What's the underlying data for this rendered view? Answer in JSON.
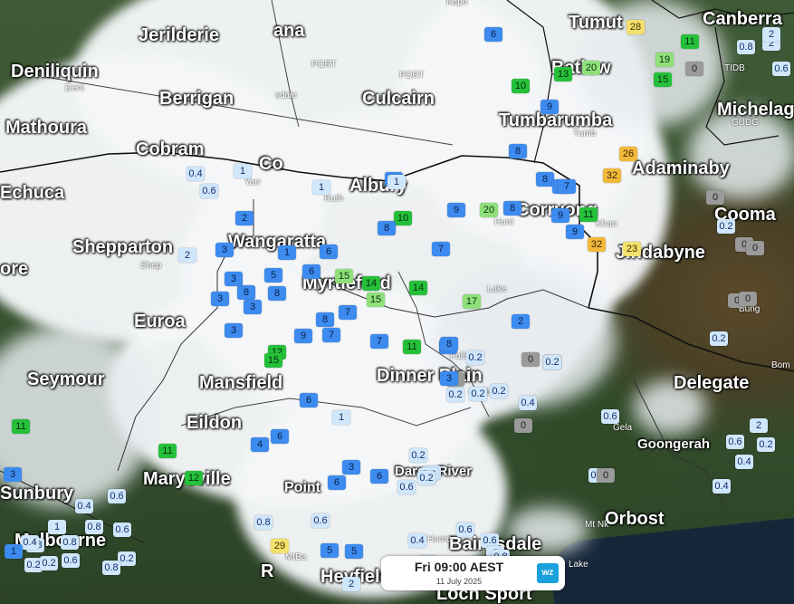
{
  "map": {
    "towns": [
      {
        "name": "Jerilderie"
      },
      {
        "name": "ana"
      },
      {
        "name": "Deniliquin"
      },
      {
        "name": "Berrigan"
      },
      {
        "name": "Culcairn"
      },
      {
        "name": "Tumut"
      },
      {
        "name": "Batlow"
      },
      {
        "name": "Canberra"
      },
      {
        "name": "Mathoura"
      },
      {
        "name": "Tumbarumba"
      },
      {
        "name": "Michelago"
      },
      {
        "name": "Cobram"
      },
      {
        "name": "Co"
      },
      {
        "name": "Adaminaby"
      },
      {
        "name": "Echuca"
      },
      {
        "name": "Albury"
      },
      {
        "name": "Corryong"
      },
      {
        "name": "Cooma"
      },
      {
        "name": "Wangaratta"
      },
      {
        "name": "Shepparton"
      },
      {
        "name": "Jindabyne"
      },
      {
        "name": "Myrtleford"
      },
      {
        "name": "Euroa"
      },
      {
        "name": "Seymour"
      },
      {
        "name": "Dinner Plain"
      },
      {
        "name": "Mansfield"
      },
      {
        "name": "Delegate"
      },
      {
        "name": "Eildon"
      },
      {
        "name": "Goongerah"
      },
      {
        "name": "Marysville"
      },
      {
        "name": "Dargo River"
      },
      {
        "name": "Orbost"
      },
      {
        "name": "Bairnsdale"
      },
      {
        "name": "Melbourne"
      },
      {
        "name": "Heyfield"
      },
      {
        "name": "Loch Sport"
      },
      {
        "name": "Point"
      },
      {
        "name": "R"
      },
      {
        "name": "Sunbury"
      },
      {
        "name": "ore"
      }
    ],
    "stations": [
      "Kapo",
      "PORT",
      "PORT",
      "sdale",
      "Deni",
      "Yarr",
      "Ruth",
      "Hunt",
      "Khan",
      "Shep",
      "Lake",
      "Bung",
      "Bom",
      "Gela",
      "Mt Nk",
      "Tumb",
      "TIDB",
      "GUDG",
      "Falls",
      "Cobb",
      "Hume",
      "Lake",
      "MtBa"
    ],
    "observations": [
      {
        "v": "6",
        "c": "blue"
      },
      {
        "v": "28",
        "c": "yellow"
      },
      {
        "v": "11",
        "c": "green"
      },
      {
        "v": "2",
        "c": "light"
      },
      {
        "v": "0.8",
        "c": "light"
      },
      {
        "v": "2",
        "c": "light"
      },
      {
        "v": "0.6",
        "c": "light"
      },
      {
        "v": "20",
        "c": "lgreen"
      },
      {
        "v": "13",
        "c": "green"
      },
      {
        "v": "19",
        "c": "lgreen"
      },
      {
        "v": "0",
        "c": "grey"
      },
      {
        "v": "15",
        "c": "green"
      },
      {
        "v": "10",
        "c": "green"
      },
      {
        "v": "8",
        "c": "blue"
      },
      {
        "v": "8",
        "c": "blue"
      },
      {
        "v": "9",
        "c": "blue"
      },
      {
        "v": "26",
        "c": "amber"
      },
      {
        "v": "32",
        "c": "amber"
      },
      {
        "v": "0.4",
        "c": "light"
      },
      {
        "v": "1",
        "c": "light"
      },
      {
        "v": "0.6",
        "c": "light"
      },
      {
        "v": "1",
        "c": "light"
      },
      {
        "v": "5",
        "c": "blue"
      },
      {
        "v": "1",
        "c": "light"
      },
      {
        "v": "10",
        "c": "green"
      },
      {
        "v": "9",
        "c": "blue"
      },
      {
        "v": "20",
        "c": "lgreen"
      },
      {
        "v": "8",
        "c": "blue"
      },
      {
        "v": "11",
        "c": "green"
      },
      {
        "v": "0",
        "c": "grey"
      },
      {
        "v": "2",
        "c": "blue"
      },
      {
        "v": "9",
        "c": "blue"
      },
      {
        "v": "32",
        "c": "amber"
      },
      {
        "v": "23",
        "c": "yellow"
      },
      {
        "v": "0.2",
        "c": "light"
      },
      {
        "v": "0",
        "c": "grey"
      },
      {
        "v": "0",
        "c": "grey"
      },
      {
        "v": "2",
        "c": "light"
      },
      {
        "v": "3",
        "c": "blue"
      },
      {
        "v": "1",
        "c": "blue"
      },
      {
        "v": "6",
        "c": "blue"
      },
      {
        "v": "8",
        "c": "blue"
      },
      {
        "v": "7",
        "c": "blue"
      },
      {
        "v": "15",
        "c": "lgreen"
      },
      {
        "v": "14",
        "c": "green"
      },
      {
        "v": "14",
        "c": "green"
      },
      {
        "v": "15",
        "c": "lgreen"
      },
      {
        "v": "17",
        "c": "lgreen"
      },
      {
        "v": "5",
        "c": "blue"
      },
      {
        "v": "3",
        "c": "blue"
      },
      {
        "v": "8",
        "c": "blue"
      },
      {
        "v": "8",
        "c": "blue"
      },
      {
        "v": "6",
        "c": "blue"
      },
      {
        "v": "3",
        "c": "blue"
      },
      {
        "v": "3",
        "c": "blue"
      },
      {
        "v": "7",
        "c": "blue"
      },
      {
        "v": "8",
        "c": "blue"
      },
      {
        "v": "7",
        "c": "blue"
      },
      {
        "v": "3",
        "c": "blue"
      },
      {
        "v": "9",
        "c": "blue"
      },
      {
        "v": "7",
        "c": "blue"
      },
      {
        "v": "0",
        "c": "grey"
      },
      {
        "v": "0",
        "c": "grey"
      },
      {
        "v": "2",
        "c": "blue"
      },
      {
        "v": "0.2",
        "c": "light"
      },
      {
        "v": "9",
        "c": "blue"
      },
      {
        "v": "7",
        "c": "blue"
      },
      {
        "v": "9",
        "c": "blue"
      },
      {
        "v": "11",
        "c": "green"
      },
      {
        "v": "8",
        "c": "blue"
      },
      {
        "v": "0.2",
        "c": "light"
      },
      {
        "v": "0",
        "c": "grey"
      },
      {
        "v": "0.4",
        "c": "light"
      },
      {
        "v": "0",
        "c": "grey"
      },
      {
        "v": "12",
        "c": "green"
      },
      {
        "v": "15",
        "c": "green"
      },
      {
        "v": "6",
        "c": "blue"
      },
      {
        "v": "6",
        "c": "blue"
      },
      {
        "v": "1",
        "c": "light"
      },
      {
        "v": "4",
        "c": "blue"
      },
      {
        "v": "8",
        "c": "blue"
      },
      {
        "v": "3",
        "c": "blue"
      },
      {
        "v": "0.2",
        "c": "light"
      },
      {
        "v": "0.2",
        "c": "light"
      },
      {
        "v": "0.2",
        "c": "light"
      },
      {
        "v": "0.4",
        "c": "light"
      },
      {
        "v": "0",
        "c": "grey"
      },
      {
        "v": "0.2",
        "c": "light"
      },
      {
        "v": "0.6",
        "c": "light"
      },
      {
        "v": "0.2",
        "c": "light"
      },
      {
        "v": "1",
        "c": "light"
      },
      {
        "v": "0.4",
        "c": "light"
      },
      {
        "v": "0",
        "c": "grey"
      },
      {
        "v": "2",
        "c": "light"
      },
      {
        "v": "0.6",
        "c": "light"
      },
      {
        "v": "0.2",
        "c": "light"
      },
      {
        "v": "0.4",
        "c": "light"
      },
      {
        "v": "0.4",
        "c": "light"
      },
      {
        "v": "0.6",
        "c": "light"
      },
      {
        "v": "0.6",
        "c": "light"
      },
      {
        "v": "2",
        "c": "light"
      },
      {
        "v": "0.8",
        "c": "light"
      },
      {
        "v": "0.4",
        "c": "light"
      },
      {
        "v": "0.8",
        "c": "light"
      },
      {
        "v": "0.6",
        "c": "light"
      },
      {
        "v": "29",
        "c": "yellow"
      },
      {
        "v": "11",
        "c": "green"
      },
      {
        "v": "11",
        "c": "green"
      },
      {
        "v": "12",
        "c": "green"
      },
      {
        "v": "2",
        "c": "light"
      },
      {
        "v": "5",
        "c": "blue"
      },
      {
        "v": "5",
        "c": "blue"
      },
      {
        "v": "6",
        "c": "blue"
      },
      {
        "v": "3",
        "c": "blue"
      },
      {
        "v": "6",
        "c": "blue"
      },
      {
        "v": "0.6",
        "c": "light"
      },
      {
        "v": "0.2",
        "c": "light"
      },
      {
        "v": "0.6",
        "c": "light"
      },
      {
        "v": "0.8",
        "c": "light"
      },
      {
        "v": "0.6",
        "c": "light"
      },
      {
        "v": "0.8",
        "c": "light"
      },
      {
        "v": "1",
        "c": "light"
      },
      {
        "v": "0.8",
        "c": "light"
      },
      {
        "v": "0.2",
        "c": "light"
      },
      {
        "v": "0.4",
        "c": "light"
      },
      {
        "v": "0.6",
        "c": "light"
      },
      {
        "v": "0.2",
        "c": "light"
      },
      {
        "v": "0.2",
        "c": "light"
      },
      {
        "v": "0.8",
        "c": "light"
      },
      {
        "v": "0.8",
        "c": "light"
      },
      {
        "v": "0.6",
        "c": "light"
      },
      {
        "v": "0.4",
        "c": "light"
      },
      {
        "v": "3",
        "c": "blue"
      },
      {
        "v": "1",
        "c": "blue"
      }
    ]
  },
  "time_panel": {
    "main": "Fri 09:00 AEST",
    "date": "11 July 2025",
    "logo": "wz"
  },
  "colors": {
    "light": "#cfe6fb",
    "blue": "#3d8bef",
    "grey": "#9a9a9a",
    "green": "#25c03a",
    "lgreen": "#8fe07a",
    "amber": "#f2b93a",
    "yellow": "#f4e06a"
  }
}
